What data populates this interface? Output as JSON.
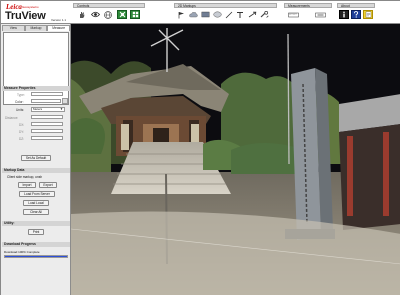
{
  "logo": {
    "brand": "Leica",
    "sub": "Geosystems",
    "product": "TruView",
    "version": "Version 1.1"
  },
  "toolbar": {
    "groups": {
      "controls": "Controls",
      "markups": "2D Markups",
      "measurements": "Measurements",
      "about": "About"
    },
    "icons": {
      "controls": [
        "hand-icon",
        "eye-icon",
        "globe-icon",
        "fit-view-icon",
        "grid-view-icon"
      ],
      "markups": [
        "flag-icon",
        "cloud-icon",
        "rectangle-icon",
        "ellipse-icon",
        "line-icon",
        "text-icon",
        "arrow-icon",
        "wrench-icon"
      ],
      "measurements": [
        "measure-distance-icon",
        "measure-coordinate-icon"
      ],
      "about": [
        "info-icon",
        "help-icon",
        "notes-icon"
      ]
    }
  },
  "left_panel": {
    "tabs": [
      "View",
      "Markup",
      "Measure"
    ],
    "active_tab": "Measure",
    "measure_properties": {
      "title": "Measure Properties",
      "type_label": "Type:",
      "color_label": "Color:",
      "units_label": "Units:",
      "units_value": "Meters",
      "distance_label": "Distance:",
      "dx_label": "DX:",
      "dy_label": "DY:",
      "dz_label": "DZ:",
      "set_default": "Set As Default"
    },
    "markup_data": {
      "title": "Markup Data",
      "note": "Client side markup, unsh",
      "import": "Import",
      "export": "Export",
      "load_server": "Load From Server",
      "load_local": "Load Local",
      "clear_all": "Clear All"
    },
    "utility": {
      "title": "Utility:",
      "print": "Print"
    },
    "download": {
      "title": "Download Progress",
      "status": "Download 100% Complete",
      "progress": 1.0
    }
  },
  "viewport": {
    "description": "panoramic laser scan of a shrine",
    "colors": {
      "sky": "#0c0c10",
      "ground": "#8a8272"
    }
  }
}
